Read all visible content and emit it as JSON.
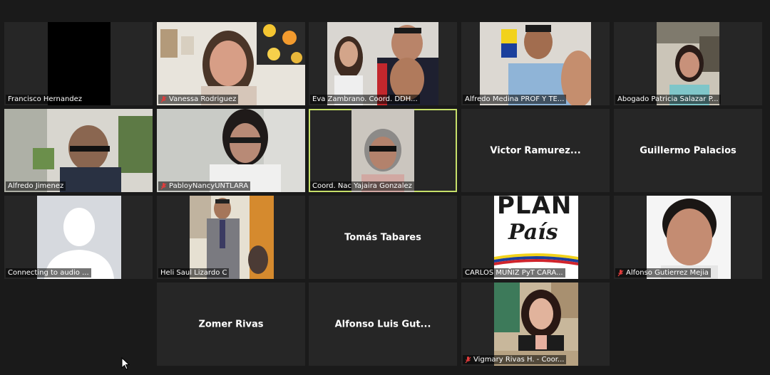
{
  "participants": [
    {
      "name": "Francisco Hernandez",
      "muted": false
    },
    {
      "name": "Vanessa Rodriguez",
      "muted": true
    },
    {
      "name": "Eva Zambrano. Coord. DDH...",
      "muted": false
    },
    {
      "name": "Alfredo Medina PROF Y TE...",
      "muted": false
    },
    {
      "name": "Abogado Patricia Salazar P...",
      "muted": false
    },
    {
      "name": "Alfredo Jimenez",
      "muted": false
    },
    {
      "name": "PabloyNancyUNTLARA",
      "muted": true
    },
    {
      "name": "Coord. Nac Yajaira Gonzalez",
      "muted": false
    },
    {
      "name": "Victor  Ramurez...",
      "muted": false
    },
    {
      "name": "Guillermo Palacios",
      "muted": false
    },
    {
      "name": "Connecting to audio ...",
      "muted": false
    },
    {
      "name": "Heli Saul Lizardo C",
      "muted": false
    },
    {
      "name": "Tomás Tabares",
      "muted": false
    },
    {
      "name": "CARLOS MUÑIZ  PyT  CARA...",
      "muted": false
    },
    {
      "name": "Alfonso Gutierrez Mejia",
      "muted": true
    },
    {
      "name": "Zomer Rivas",
      "muted": false
    },
    {
      "name": "Alfonso  Luis  Gut...",
      "muted": false
    },
    {
      "name": "Vigmary Rivas H. - Coor...",
      "muted": true
    }
  ],
  "logo_text": {
    "top": "PLAN",
    "bottom": "País"
  },
  "colors": {
    "background": "#1a1a1a",
    "tile": "#262626",
    "active_border": "#c7e06a",
    "mute": "#e03c3c"
  }
}
